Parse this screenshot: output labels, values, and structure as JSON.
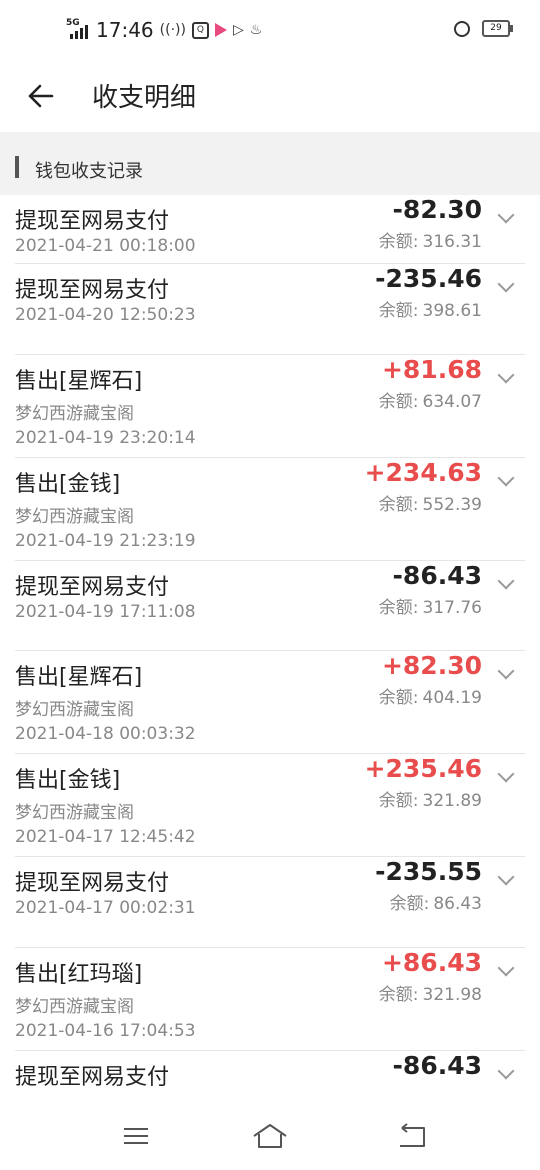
{
  "status_bar": {
    "network": "5G",
    "time": "17:46",
    "battery": "29",
    "icons": [
      "hotspot-icon",
      "app-q-icon",
      "video-app-icon",
      "play-app-icon",
      "flame-app-icon",
      "alarm-icon",
      "battery-icon"
    ]
  },
  "header": {
    "title": "收支明细",
    "back_icon": "arrow-left-icon"
  },
  "section": {
    "label": "钱包收支记录"
  },
  "records": [
    {
      "name": "提现至网易支付",
      "source": "",
      "datetime": "2021-04-21 00:18:00",
      "amount": "-82.30",
      "balance_label": "余额:",
      "balance": "316.31",
      "positive": false
    },
    {
      "name": "提现至网易支付",
      "source": "",
      "datetime": "2021-04-20 12:50:23",
      "amount": "-235.46",
      "balance_label": "余额:",
      "balance": "398.61",
      "positive": false
    },
    {
      "name": "售出[星辉石]",
      "source": "梦幻西游藏宝阁",
      "datetime": "2021-04-19 23:20:14",
      "amount": "+81.68",
      "balance_label": "余额:",
      "balance": "634.07",
      "positive": true
    },
    {
      "name": "售出[金钱]",
      "source": "梦幻西游藏宝阁",
      "datetime": "2021-04-19 21:23:19",
      "amount": "+234.63",
      "balance_label": "余额:",
      "balance": "552.39",
      "positive": true
    },
    {
      "name": "提现至网易支付",
      "source": "",
      "datetime": "2021-04-19 17:11:08",
      "amount": "-86.43",
      "balance_label": "余额:",
      "balance": "317.76",
      "positive": false
    },
    {
      "name": "售出[星辉石]",
      "source": "梦幻西游藏宝阁",
      "datetime": "2021-04-18 00:03:32",
      "amount": "+82.30",
      "balance_label": "余额:",
      "balance": "404.19",
      "positive": true
    },
    {
      "name": "售出[金钱]",
      "source": "梦幻西游藏宝阁",
      "datetime": "2021-04-17 12:45:42",
      "amount": "+235.46",
      "balance_label": "余额:",
      "balance": "321.89",
      "positive": true
    },
    {
      "name": "提现至网易支付",
      "source": "",
      "datetime": "2021-04-17 00:02:31",
      "amount": "-235.55",
      "balance_label": "余额:",
      "balance": "86.43",
      "positive": false
    },
    {
      "name": "售出[红玛瑙]",
      "source": "梦幻西游藏宝阁",
      "datetime": "2021-04-16 17:04:53",
      "amount": "+86.43",
      "balance_label": "余额:",
      "balance": "321.98",
      "positive": true
    },
    {
      "name": "提现至网易支付",
      "source": "",
      "datetime": "",
      "amount": "-86.43",
      "balance_label": "",
      "balance": "",
      "positive": false
    }
  ],
  "colors": {
    "positive": "#e84c4c",
    "negative": "#222222",
    "section_bg": "#f2f2f2"
  },
  "nav": {
    "icons": [
      "menu-icon",
      "home-icon",
      "back-icon"
    ]
  }
}
